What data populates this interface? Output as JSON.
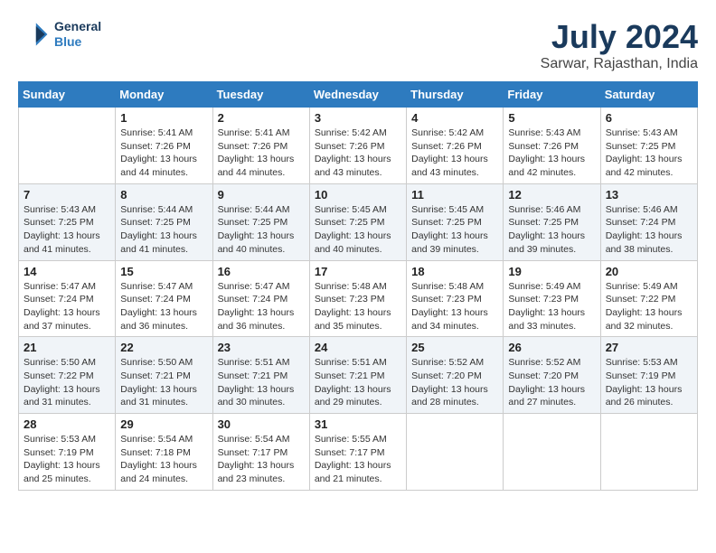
{
  "header": {
    "logo_line1": "General",
    "logo_line2": "Blue",
    "main_title": "July 2024",
    "subtitle": "Sarwar, Rajasthan, India"
  },
  "days_of_week": [
    "Sunday",
    "Monday",
    "Tuesday",
    "Wednesday",
    "Thursday",
    "Friday",
    "Saturday"
  ],
  "weeks": [
    [
      {
        "day": "",
        "info": ""
      },
      {
        "day": "1",
        "info": "Sunrise: 5:41 AM\nSunset: 7:26 PM\nDaylight: 13 hours\nand 44 minutes."
      },
      {
        "day": "2",
        "info": "Sunrise: 5:41 AM\nSunset: 7:26 PM\nDaylight: 13 hours\nand 44 minutes."
      },
      {
        "day": "3",
        "info": "Sunrise: 5:42 AM\nSunset: 7:26 PM\nDaylight: 13 hours\nand 43 minutes."
      },
      {
        "day": "4",
        "info": "Sunrise: 5:42 AM\nSunset: 7:26 PM\nDaylight: 13 hours\nand 43 minutes."
      },
      {
        "day": "5",
        "info": "Sunrise: 5:43 AM\nSunset: 7:26 PM\nDaylight: 13 hours\nand 42 minutes."
      },
      {
        "day": "6",
        "info": "Sunrise: 5:43 AM\nSunset: 7:25 PM\nDaylight: 13 hours\nand 42 minutes."
      }
    ],
    [
      {
        "day": "7",
        "info": "Sunrise: 5:43 AM\nSunset: 7:25 PM\nDaylight: 13 hours\nand 41 minutes."
      },
      {
        "day": "8",
        "info": "Sunrise: 5:44 AM\nSunset: 7:25 PM\nDaylight: 13 hours\nand 41 minutes."
      },
      {
        "day": "9",
        "info": "Sunrise: 5:44 AM\nSunset: 7:25 PM\nDaylight: 13 hours\nand 40 minutes."
      },
      {
        "day": "10",
        "info": "Sunrise: 5:45 AM\nSunset: 7:25 PM\nDaylight: 13 hours\nand 40 minutes."
      },
      {
        "day": "11",
        "info": "Sunrise: 5:45 AM\nSunset: 7:25 PM\nDaylight: 13 hours\nand 39 minutes."
      },
      {
        "day": "12",
        "info": "Sunrise: 5:46 AM\nSunset: 7:25 PM\nDaylight: 13 hours\nand 39 minutes."
      },
      {
        "day": "13",
        "info": "Sunrise: 5:46 AM\nSunset: 7:24 PM\nDaylight: 13 hours\nand 38 minutes."
      }
    ],
    [
      {
        "day": "14",
        "info": "Sunrise: 5:47 AM\nSunset: 7:24 PM\nDaylight: 13 hours\nand 37 minutes."
      },
      {
        "day": "15",
        "info": "Sunrise: 5:47 AM\nSunset: 7:24 PM\nDaylight: 13 hours\nand 36 minutes."
      },
      {
        "day": "16",
        "info": "Sunrise: 5:47 AM\nSunset: 7:24 PM\nDaylight: 13 hours\nand 36 minutes."
      },
      {
        "day": "17",
        "info": "Sunrise: 5:48 AM\nSunset: 7:23 PM\nDaylight: 13 hours\nand 35 minutes."
      },
      {
        "day": "18",
        "info": "Sunrise: 5:48 AM\nSunset: 7:23 PM\nDaylight: 13 hours\nand 34 minutes."
      },
      {
        "day": "19",
        "info": "Sunrise: 5:49 AM\nSunset: 7:23 PM\nDaylight: 13 hours\nand 33 minutes."
      },
      {
        "day": "20",
        "info": "Sunrise: 5:49 AM\nSunset: 7:22 PM\nDaylight: 13 hours\nand 32 minutes."
      }
    ],
    [
      {
        "day": "21",
        "info": "Sunrise: 5:50 AM\nSunset: 7:22 PM\nDaylight: 13 hours\nand 31 minutes."
      },
      {
        "day": "22",
        "info": "Sunrise: 5:50 AM\nSunset: 7:21 PM\nDaylight: 13 hours\nand 31 minutes."
      },
      {
        "day": "23",
        "info": "Sunrise: 5:51 AM\nSunset: 7:21 PM\nDaylight: 13 hours\nand 30 minutes."
      },
      {
        "day": "24",
        "info": "Sunrise: 5:51 AM\nSunset: 7:21 PM\nDaylight: 13 hours\nand 29 minutes."
      },
      {
        "day": "25",
        "info": "Sunrise: 5:52 AM\nSunset: 7:20 PM\nDaylight: 13 hours\nand 28 minutes."
      },
      {
        "day": "26",
        "info": "Sunrise: 5:52 AM\nSunset: 7:20 PM\nDaylight: 13 hours\nand 27 minutes."
      },
      {
        "day": "27",
        "info": "Sunrise: 5:53 AM\nSunset: 7:19 PM\nDaylight: 13 hours\nand 26 minutes."
      }
    ],
    [
      {
        "day": "28",
        "info": "Sunrise: 5:53 AM\nSunset: 7:19 PM\nDaylight: 13 hours\nand 25 minutes."
      },
      {
        "day": "29",
        "info": "Sunrise: 5:54 AM\nSunset: 7:18 PM\nDaylight: 13 hours\nand 24 minutes."
      },
      {
        "day": "30",
        "info": "Sunrise: 5:54 AM\nSunset: 7:17 PM\nDaylight: 13 hours\nand 23 minutes."
      },
      {
        "day": "31",
        "info": "Sunrise: 5:55 AM\nSunset: 7:17 PM\nDaylight: 13 hours\nand 21 minutes."
      },
      {
        "day": "",
        "info": ""
      },
      {
        "day": "",
        "info": ""
      },
      {
        "day": "",
        "info": ""
      }
    ]
  ]
}
